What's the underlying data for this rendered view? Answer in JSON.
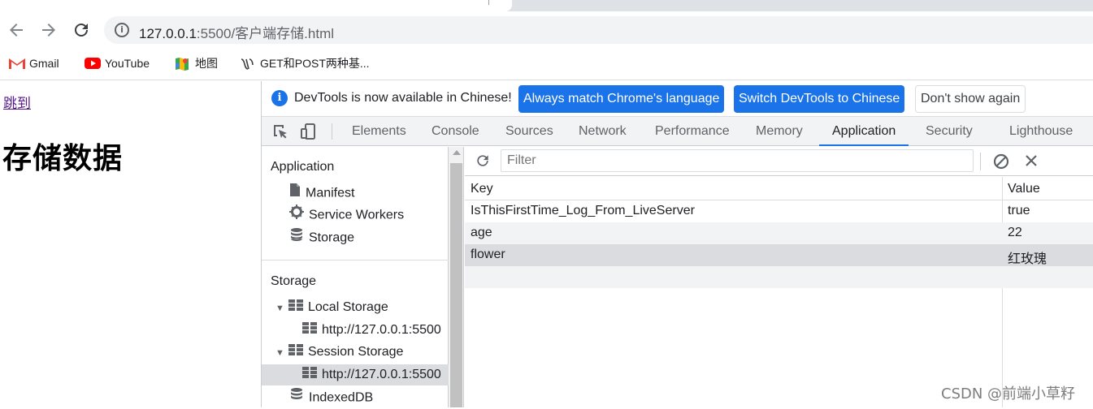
{
  "browser": {
    "url_host": "127.0.0.1",
    "url_rest": ":5500/客户端存储.html",
    "bookmarks": [
      {
        "label": "Gmail",
        "icon": "gmail-icon"
      },
      {
        "label": "YouTube",
        "icon": "youtube-icon"
      },
      {
        "label": "地图",
        "icon": "maps-icon"
      },
      {
        "label": "GET和POST两种基...",
        "icon": "bookmark-site-icon"
      }
    ]
  },
  "page": {
    "link": "跳到",
    "heading": "存储数据"
  },
  "devtools": {
    "infobar": {
      "message": "DevTools is now available in Chinese!",
      "btn_match": "Always match Chrome's language",
      "btn_switch": "Switch DevTools to Chinese",
      "btn_dismiss": "Don't show again"
    },
    "tabs": [
      "Elements",
      "Console",
      "Sources",
      "Network",
      "Performance",
      "Memory",
      "Application",
      "Security",
      "Lighthouse"
    ],
    "active_tab": "Application",
    "tree": {
      "app_header": "Application",
      "app_items": [
        "Manifest",
        "Service Workers",
        "Storage"
      ],
      "storage_header": "Storage",
      "local_storage": "Local Storage",
      "local_origin": "http://127.0.0.1:5500",
      "session_storage": "Session Storage",
      "session_origin": "http://127.0.0.1:5500",
      "indexeddb": "IndexedDB"
    },
    "filter_placeholder": "Filter",
    "table": {
      "col_key": "Key",
      "col_value": "Value",
      "rows": [
        {
          "key": "IsThisFirstTime_Log_From_LiveServer",
          "value": "true"
        },
        {
          "key": "age",
          "value": "22"
        },
        {
          "key": "flower",
          "value": "红玫瑰"
        }
      ]
    },
    "accent": "#1a73e8"
  },
  "watermark": "CSDN @前端小草籽"
}
